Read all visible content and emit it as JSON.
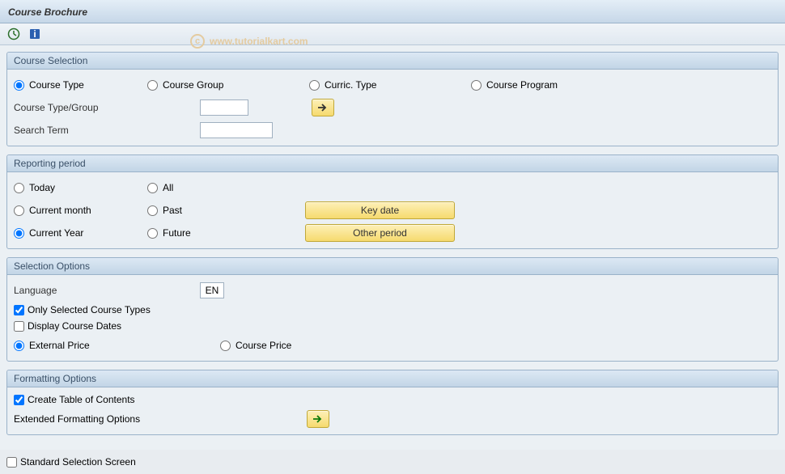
{
  "title": "Course Brochure",
  "watermark": "www.tutorialkart.com",
  "groups": {
    "selection": {
      "title": "Course Selection",
      "radios": {
        "course_type": "Course Type",
        "course_group": "Course Group",
        "curric_type": "Curric. Type",
        "course_program": "Course Program"
      },
      "labels": {
        "type_group": "Course Type/Group",
        "search_term": "Search Term"
      },
      "values": {
        "type_group": "",
        "search_term": ""
      }
    },
    "reporting": {
      "title": "Reporting period",
      "radios": {
        "today": "Today",
        "current_month": "Current month",
        "current_year": "Current Year",
        "all": "All",
        "past": "Past",
        "future": "Future"
      },
      "buttons": {
        "key_date": "Key date",
        "other_period": "Other period"
      }
    },
    "options": {
      "title": "Selection Options",
      "labels": {
        "language": "Language"
      },
      "values": {
        "language": "EN"
      },
      "checkboxes": {
        "only_selected": "Only Selected Course Types",
        "display_dates": "Display Course Dates"
      },
      "radios": {
        "external_price": "External Price",
        "course_price": "Course Price"
      }
    },
    "formatting": {
      "title": "Formatting Options",
      "checkboxes": {
        "toc": "Create Table of Contents"
      },
      "labels": {
        "extended": "Extended Formatting Options"
      }
    }
  },
  "footer": {
    "standard_selection": "Standard Selection Screen"
  }
}
